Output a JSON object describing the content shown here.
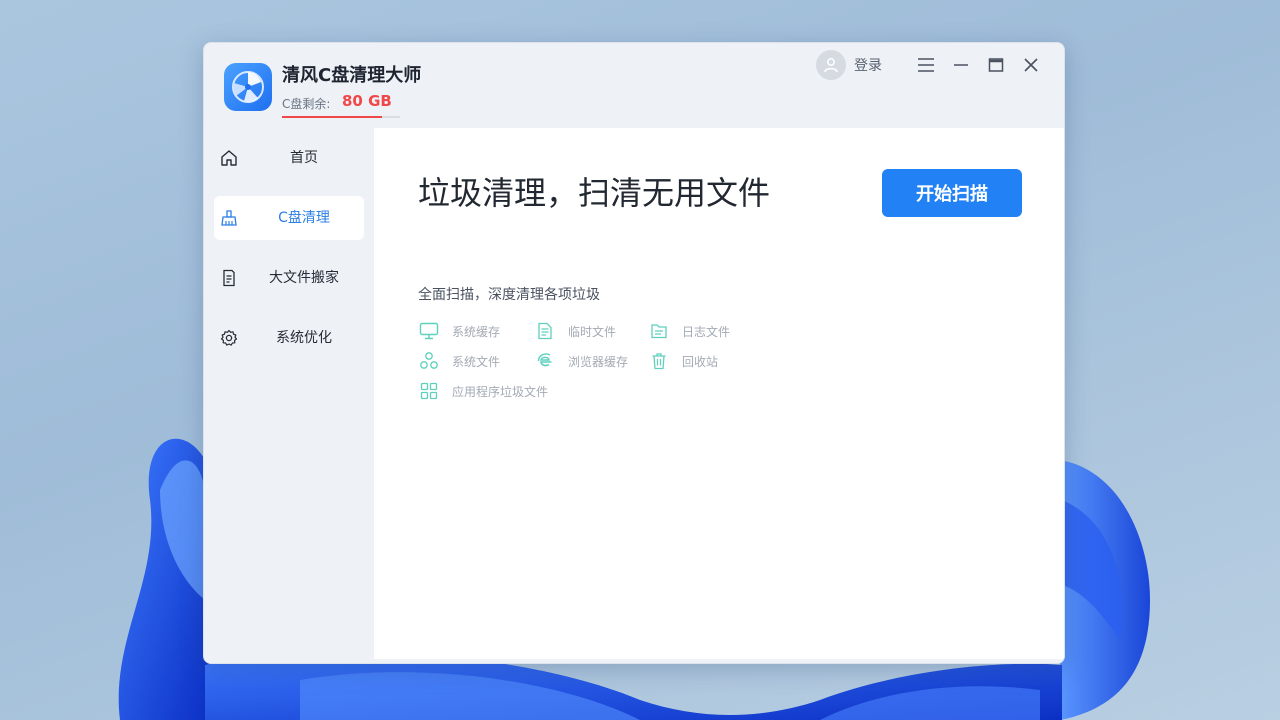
{
  "app": {
    "title": "清风C盘清理大师",
    "logo_icon": "fan-logo-icon",
    "disk_label": "C盘剩余:",
    "disk_value": "80 GB",
    "disk_usage_fraction": 0.85,
    "accent_color": "#2281f5",
    "warning_color": "#f04848"
  },
  "topbar": {
    "login_label": "登录",
    "avatar_icon": "user-avatar-icon",
    "menu_icon": "hamburger-menu-icon",
    "minimize_icon": "minimize-icon",
    "maximize_icon": "maximize-icon",
    "close_icon": "close-icon"
  },
  "sidebar": {
    "items": [
      {
        "label": "首页",
        "icon": "home-icon",
        "active": false
      },
      {
        "label": "C盘清理",
        "icon": "broom-icon",
        "active": true
      },
      {
        "label": "大文件搬家",
        "icon": "file-move-icon",
        "active": false
      },
      {
        "label": "系统优化",
        "icon": "gear-icon",
        "active": false
      }
    ]
  },
  "main": {
    "headline": "垃圾清理，扫清无用文件",
    "scan_button": "开始扫描",
    "subtitle": "全面扫描，深度清理各项垃圾",
    "features": [
      {
        "label": "系统缓存",
        "icon": "monitor-icon"
      },
      {
        "label": "临时文件",
        "icon": "document-icon"
      },
      {
        "label": "日志文件",
        "icon": "folder-log-icon"
      },
      {
        "label": "系统文件",
        "icon": "nodes-icon"
      },
      {
        "label": "浏览器缓存",
        "icon": "browser-icon"
      },
      {
        "label": "回收站",
        "icon": "trash-icon"
      },
      {
        "label": "应用程序垃圾文件",
        "icon": "apps-grid-icon"
      }
    ]
  }
}
